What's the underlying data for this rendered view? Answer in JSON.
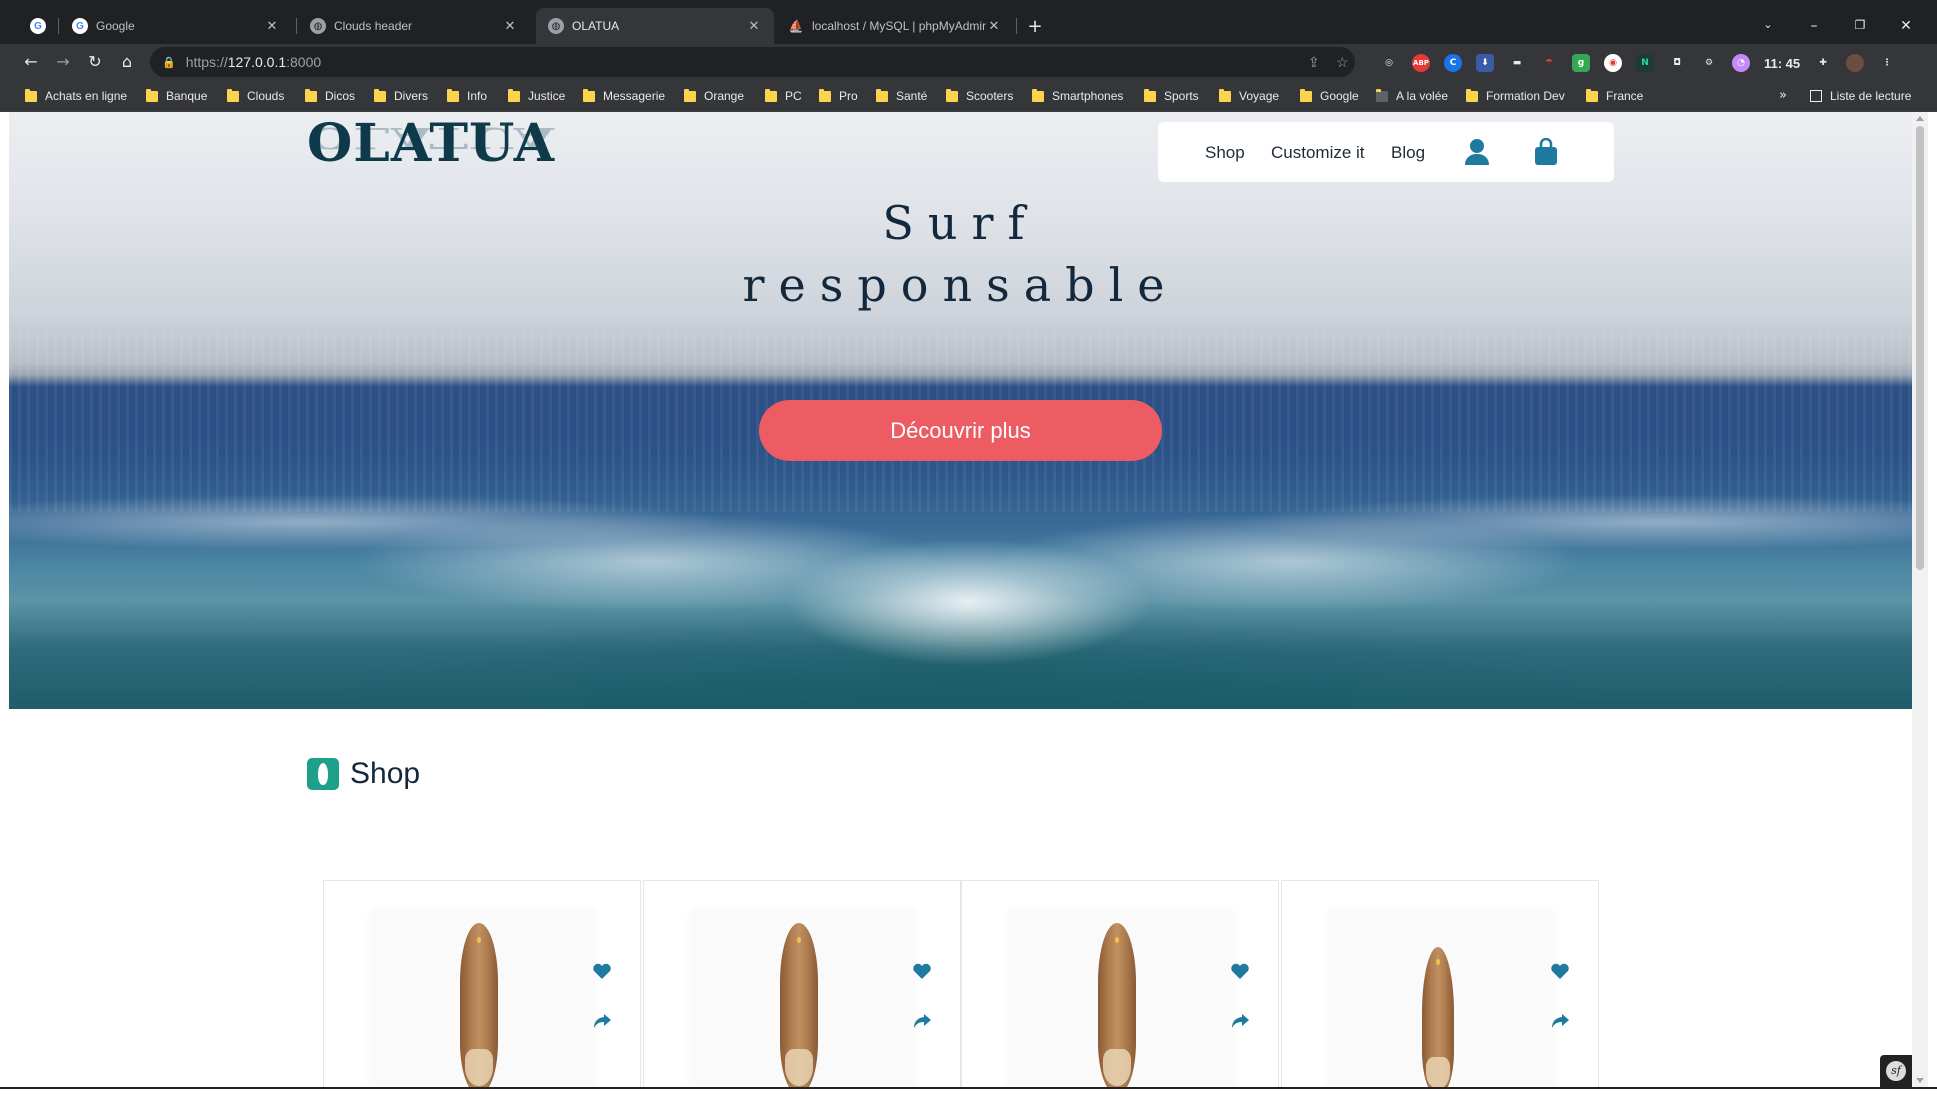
{
  "browser": {
    "tabs": [
      {
        "label": "Google",
        "active": false
      },
      {
        "label": "Clouds header",
        "active": false
      },
      {
        "label": "OLATUA",
        "active": true
      },
      {
        "label": "localhost / MySQL | phpMyAdmin",
        "active": false
      }
    ],
    "url": {
      "scheme": "https://",
      "host": "127.0.0.1",
      "port": ":8000"
    },
    "clock": "11: 45",
    "bookmarks": [
      "Achats en ligne",
      "Banque",
      "Clouds",
      "Dicos",
      "Divers",
      "Info",
      "Justice",
      "Messagerie",
      "Orange",
      "PC",
      "Pro",
      "Santé",
      "Scooters",
      "Smartphones",
      "Sports",
      "Voyage",
      "Google",
      "A la volée",
      "Formation Dev",
      "France"
    ],
    "reading_list": "Liste de lecture",
    "more_bookmarks": "»"
  },
  "site": {
    "logo": "OLATUA",
    "nav": {
      "shop": "Shop",
      "customize": "Customize it",
      "blog": "Blog"
    },
    "hero": {
      "title_line1": "Surf",
      "title_line2": "responsable",
      "cta": "Découvrir plus"
    },
    "shop": {
      "heading": "Shop"
    },
    "products": [
      {
        "board": "longboard"
      },
      {
        "board": "longboard"
      },
      {
        "board": "longboard"
      },
      {
        "board": "shortboard"
      }
    ],
    "colors": {
      "accent_cta": "#ee5c63",
      "brand_dark": "#13283c",
      "icon_blue": "#1f7aa0",
      "shop_icon": "#1fa08a"
    },
    "icons": [
      "user-icon",
      "shopping-bag-icon",
      "heart-icon",
      "share-icon",
      "surfboard-icon"
    ]
  }
}
